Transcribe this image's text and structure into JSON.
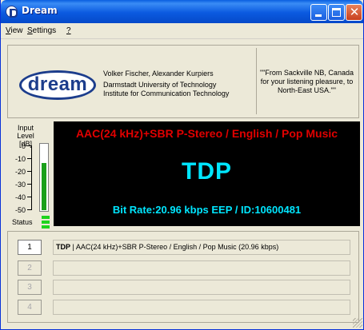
{
  "window": {
    "title": "Dream"
  },
  "menu": {
    "items": [
      {
        "accel": "V",
        "rest": "iew"
      },
      {
        "accel": "S",
        "rest": "ettings"
      },
      {
        "accel": "?",
        "rest": ""
      }
    ]
  },
  "header": {
    "logo_text": "dream",
    "credits_line1": "Volker Fischer, Alexander Kurpiers",
    "credits_line2": "Darmstadt University of Technology",
    "credits_line3": "Institute for Communication Technology",
    "station_text": "\"\"From Sackville NB, Canada for your listening pleasure, to North-East USA.\"\""
  },
  "level_meter": {
    "label_line1": "Input",
    "label_line2": "Level [dB]",
    "ticks": [
      "0",
      "-10",
      "-20",
      "-30",
      "-40",
      "-50"
    ],
    "fill_fraction": 0.72,
    "status_label": "Status"
  },
  "display": {
    "label": "AAC(24 kHz)+SBR P-Stereo / English / Pop Music",
    "station_name": "TDP",
    "bitrate": "Bit Rate:20.96 kbps EEP / ID:10600481",
    "label_color": "#e00000",
    "text_color": "#00e6ff"
  },
  "services": [
    {
      "number": "1",
      "name": "TDP",
      "desc": " | AAC(24 kHz)+SBR P-Stereo / English / Pop Music (20.96 kbps)",
      "enabled": true
    },
    {
      "number": "2",
      "name": "",
      "desc": "",
      "enabled": false
    },
    {
      "number": "3",
      "name": "",
      "desc": "",
      "enabled": false
    },
    {
      "number": "4",
      "name": "",
      "desc": "",
      "enabled": false
    }
  ]
}
